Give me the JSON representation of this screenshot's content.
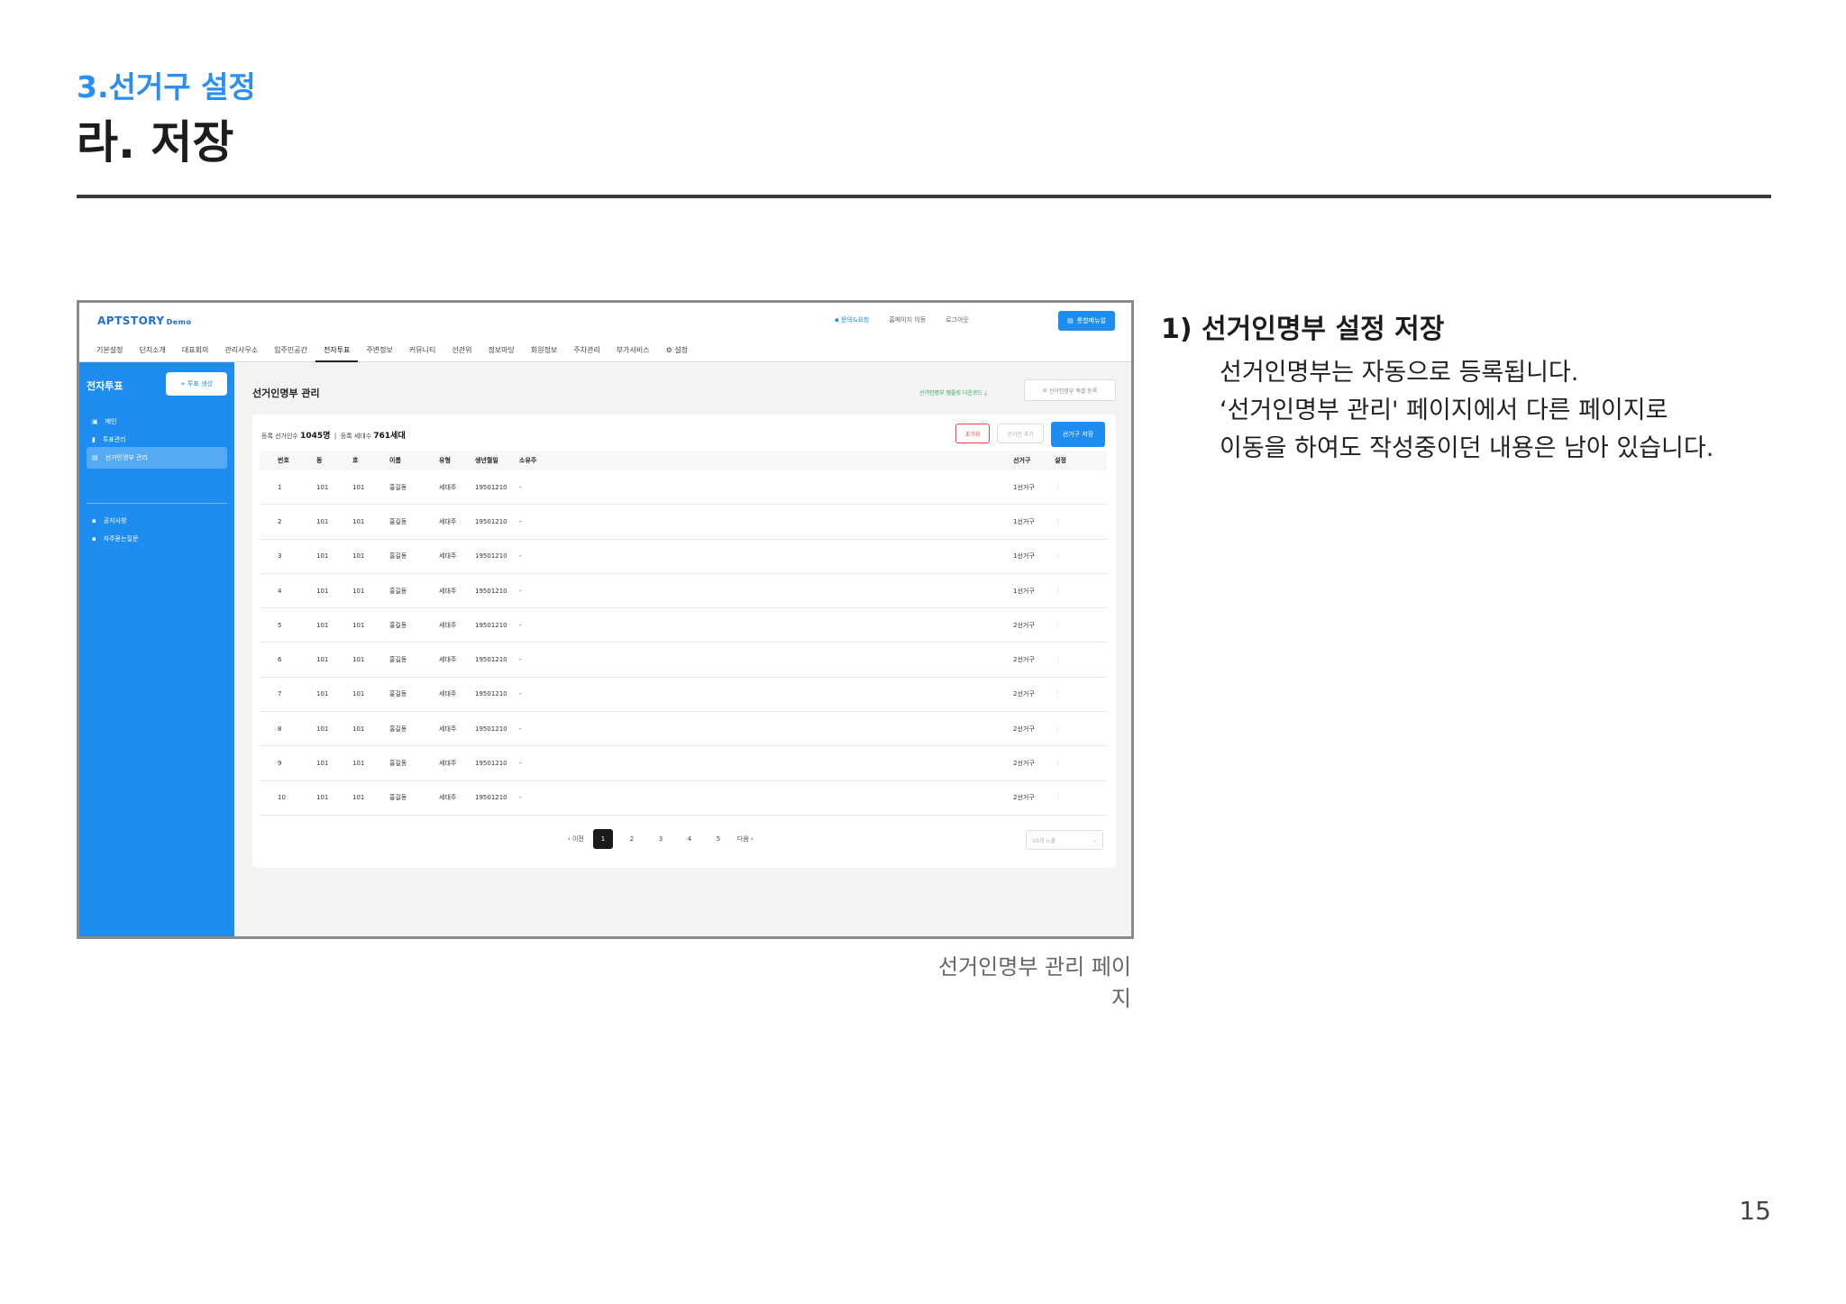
{
  "header": {
    "section": "3.선거구 설정",
    "title": "라. 저장"
  },
  "screenshot": {
    "logo": "APTSTORY",
    "logo_suffix": "Demo",
    "top_links": [
      "문의&요청",
      "홈페이지 이동",
      "로그아웃"
    ],
    "top_button": "통합메뉴얼",
    "menu": [
      "기본설정",
      "단지소개",
      "대표회의",
      "관리사무소",
      "입주민공간",
      "전자투표",
      "주변정보",
      "커뮤니티",
      "선관위",
      "정보마당",
      "회원정보",
      "주차관리",
      "부가서비스",
      "설정"
    ],
    "active_menu": "전자투표",
    "sidebar": {
      "title": "전자투표",
      "new_button": "+ 투표 생성",
      "items": [
        "메인",
        "투표관리",
        "선거인명부 관리",
        "공지사항",
        "자주묻는질문"
      ]
    },
    "content_title": "선거인명부 관리",
    "excel_link": "선거인명부 템플릿 다운로드",
    "register_button": "선거인명부 엑셀 등록",
    "stats": {
      "voters_label": "등록 선거인수",
      "voters_value": "1045명",
      "households_label": "등록 세대수",
      "households_value": "761세대"
    },
    "buttons": {
      "reset": "초기화",
      "add": "선거인 추가",
      "save": "선거구 저장"
    },
    "columns": [
      "번호",
      "동",
      "호",
      "이름",
      "유형",
      "생년월일",
      "소유주",
      "선거구",
      "설정"
    ],
    "rows": [
      [
        "1",
        "101",
        "101",
        "홍길동",
        "세대주",
        "19501210",
        "-",
        "1선거구"
      ],
      [
        "2",
        "101",
        "101",
        "홍길동",
        "세대주",
        "19501210",
        "-",
        "1선거구"
      ],
      [
        "3",
        "101",
        "101",
        "홍길동",
        "세대주",
        "19501210",
        "-",
        "1선거구"
      ],
      [
        "4",
        "101",
        "101",
        "홍길동",
        "세대주",
        "19501210",
        "-",
        "1선거구"
      ],
      [
        "5",
        "101",
        "101",
        "홍길동",
        "세대주",
        "19501210",
        "-",
        "2선거구"
      ],
      [
        "6",
        "101",
        "101",
        "홍길동",
        "세대주",
        "19501210",
        "-",
        "2선거구"
      ],
      [
        "7",
        "101",
        "101",
        "홍길동",
        "세대주",
        "19501210",
        "-",
        "2선거구"
      ],
      [
        "8",
        "101",
        "101",
        "홍길동",
        "세대주",
        "19501210",
        "-",
        "2선거구"
      ],
      [
        "9",
        "101",
        "101",
        "홍길동",
        "세대주",
        "19501210",
        "-",
        "2선거구"
      ],
      [
        "10",
        "101",
        "101",
        "홍길동",
        "세대주",
        "19501210",
        "-",
        "2선거구"
      ]
    ],
    "pagination": {
      "prev": "이전",
      "pages": [
        "1",
        "2",
        "3",
        "4",
        "5"
      ],
      "current": "1",
      "next": "다음"
    },
    "per_page": "10개 노출"
  },
  "caption": "선거인명부 관리 페이지",
  "description": {
    "title": "1) 선거인명부 설정 저장",
    "lines": [
      "선거인명부는 자동으로 등록됩니다.",
      "‘선거인명부 관리' 페이지에서 다른 페이지로",
      "이동을 하여도 작성중이던 내용은 남아 있습니다."
    ]
  },
  "page_number": "15"
}
